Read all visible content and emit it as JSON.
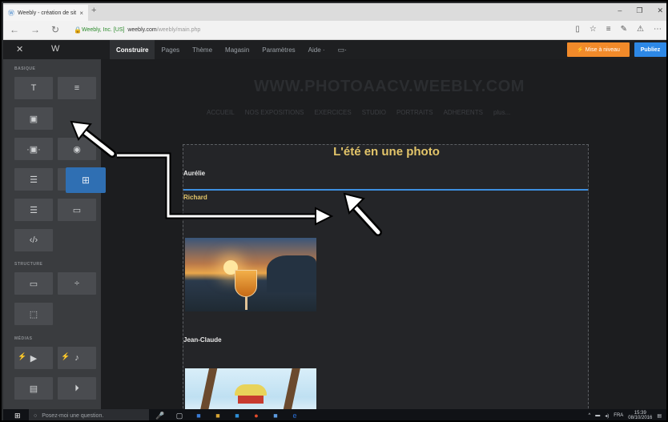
{
  "browser": {
    "tab_title": "Weebly - création de sit",
    "tab_close": "×",
    "new_tab": "+",
    "window_controls": [
      "–",
      "❐",
      "✕"
    ],
    "back": "←",
    "forward": "→",
    "refresh": "↻",
    "cert_name": "Weebly, Inc. [US]",
    "url_host": "weebly.com",
    "url_path": "/weebly/main.php",
    "right_tools": [
      "▯",
      "☆",
      "≡",
      "✎",
      "⚠",
      "⋯"
    ]
  },
  "weebly_bar": {
    "close": "✕",
    "logo": "W",
    "nav": [
      "Construire",
      "Pages",
      "Thème",
      "Magasin",
      "Paramètres",
      "Aide ·"
    ],
    "active_nav": "Construire",
    "upgrade_label": "⚡ Mise à niveau",
    "publish_label": "Publiez",
    "colors": {
      "upgrade": "#f18a2a",
      "publish": "#2d88e6"
    }
  },
  "sidebar": {
    "sections": {
      "basic": "BASIQUE",
      "structure": "STRUCTURE",
      "media": "MÉDIAS"
    }
  },
  "site": {
    "title": "WWW.PHOTOAACV.WEEBLY.COM",
    "nav": [
      "ACCUEIL",
      "NOS EXPOSITIONS",
      "EXERCICES",
      "STUDIO",
      "PORTRAITS",
      "ADHERENTS",
      "plus..."
    ]
  },
  "block": {
    "title": "L'été en une photo",
    "names": [
      "Aurélie",
      "Richard",
      "Jean-Claude"
    ],
    "accent_color": "#e3c56a",
    "drop_line_color": "#3d8fe0"
  },
  "taskbar": {
    "search_placeholder": "Posez-moi une question.",
    "language": "FRA",
    "time": "15:39",
    "date": "08/10/2016"
  }
}
